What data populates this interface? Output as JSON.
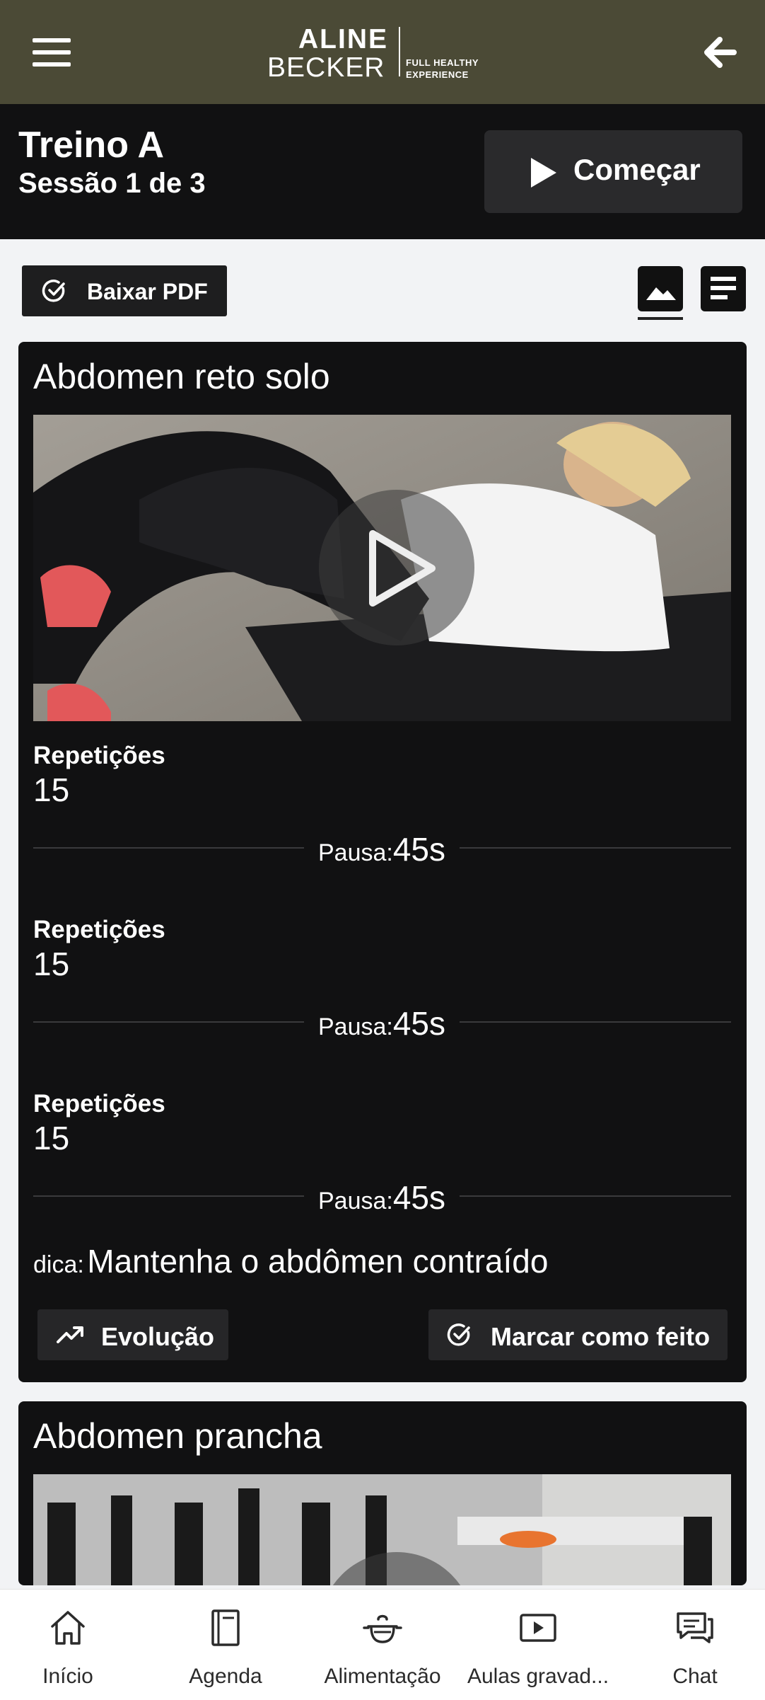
{
  "header": {
    "logo_line1": "ALINE",
    "logo_line2": "BECKER",
    "logo_tag1": "FULL HEALTHY",
    "logo_tag2": "EXPERIENCE"
  },
  "session": {
    "title": "Treino A",
    "subtitle": "Sessão 1 de 3",
    "start_label": "Começar"
  },
  "toolbar": {
    "pdf_label": "Baixar PDF",
    "active_view": "image"
  },
  "exercises": [
    {
      "name": "Abdomen reto solo",
      "sets": [
        {
          "label": "Repetições",
          "value": "15",
          "pause_label": "Pausa:",
          "pause_value": "45s"
        },
        {
          "label": "Repetições",
          "value": "15",
          "pause_label": "Pausa:",
          "pause_value": "45s"
        },
        {
          "label": "Repetições",
          "value": "15",
          "pause_label": "Pausa:",
          "pause_value": "45s"
        }
      ],
      "tip_label": "dica:",
      "tip_value": "Mantenha o abdômen contraído",
      "evolution_label": "Evolução",
      "done_label": "Marcar como feito"
    },
    {
      "name": "Abdomen prancha"
    }
  ],
  "nav": {
    "items": [
      {
        "label": "Início",
        "icon": "home-icon"
      },
      {
        "label": "Agenda",
        "icon": "notebook-icon"
      },
      {
        "label": "Alimentação",
        "icon": "food-pot-icon"
      },
      {
        "label": "Aulas gravad...",
        "icon": "video-icon"
      },
      {
        "label": "Chat",
        "icon": "chat-icon"
      }
    ]
  },
  "colors": {
    "header_bg": "#4b4a36",
    "card_bg": "#111112",
    "page_bg": "#f2f3f5"
  }
}
